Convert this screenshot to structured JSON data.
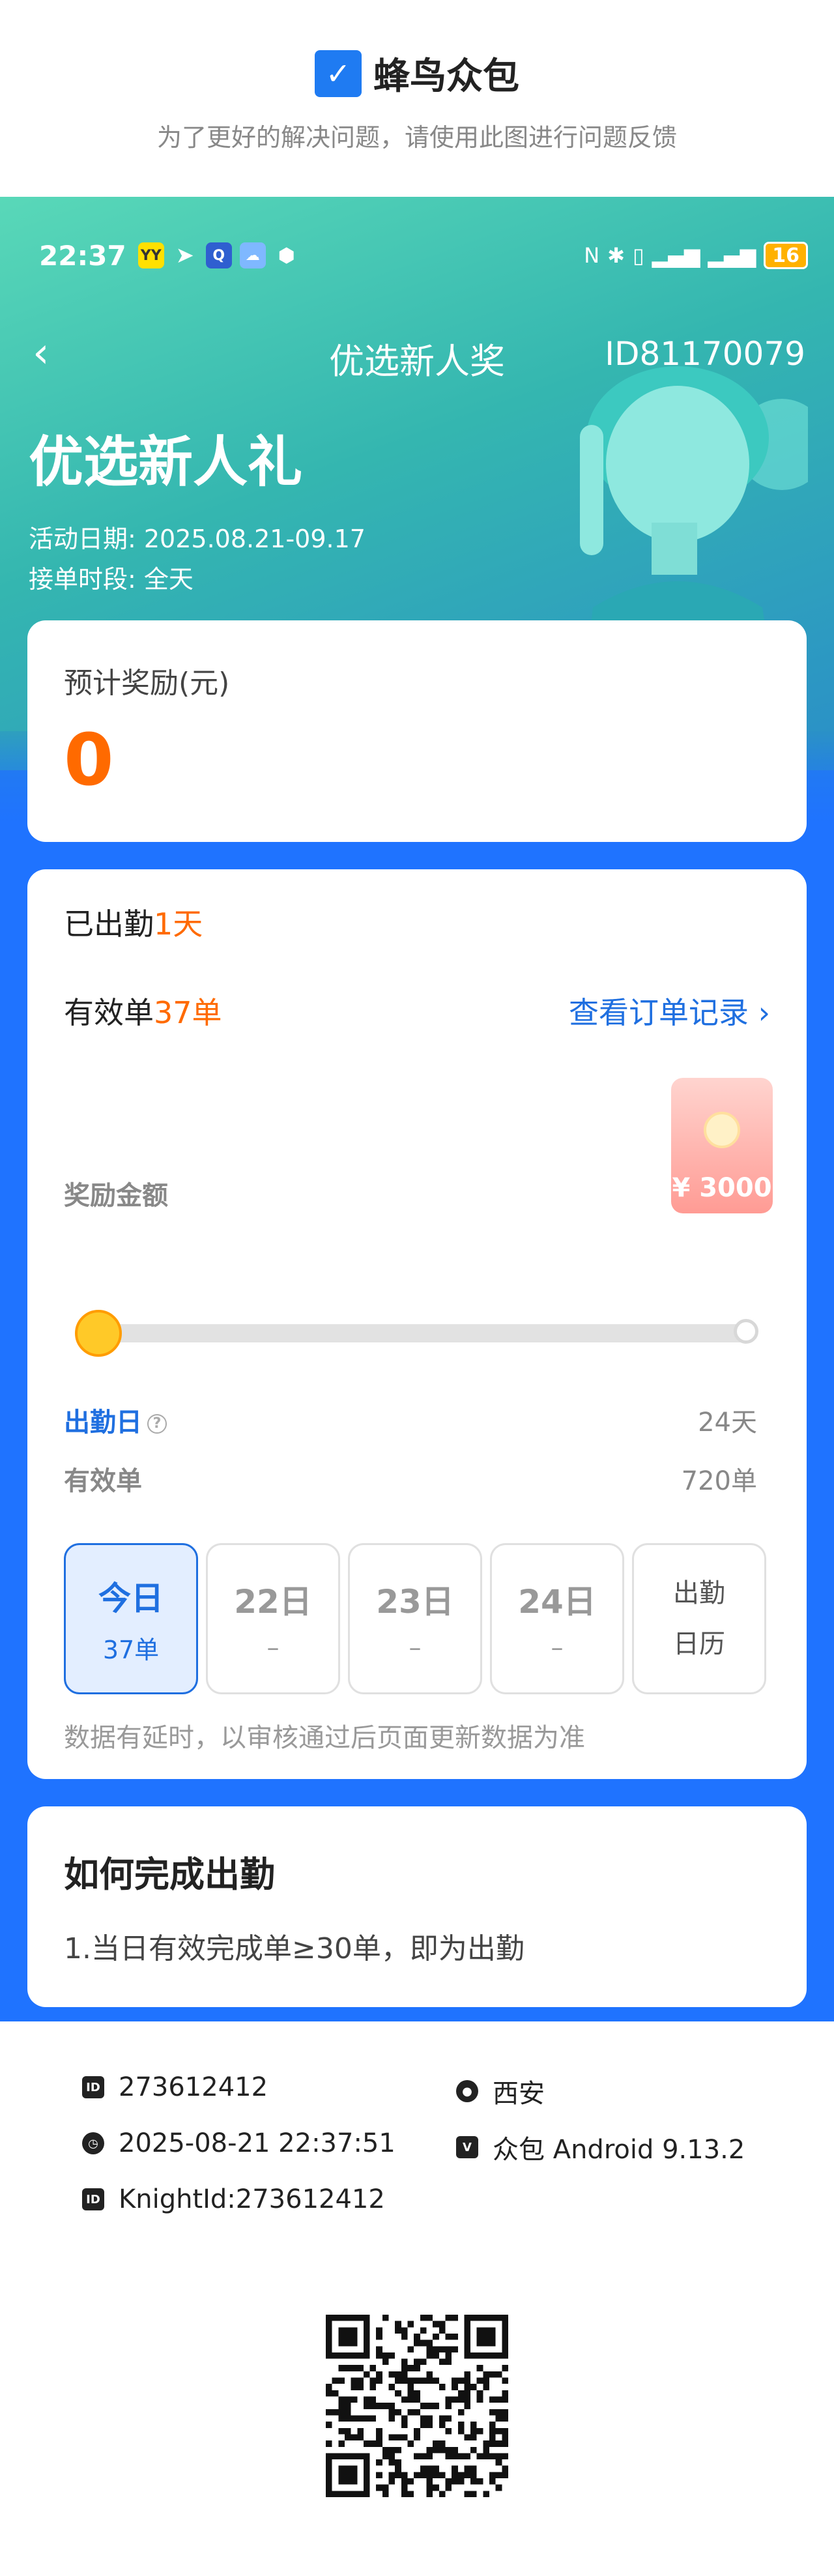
{
  "report": {
    "brand_name": "蜂鸟众包",
    "subtitle": "为了更好的解决问题，请使用此图进行问题反馈"
  },
  "status_bar": {
    "time": "22:37",
    "battery": "16"
  },
  "nav": {
    "back": "‹",
    "title": "优选新人奖",
    "id": "ID81170079"
  },
  "hero": {
    "title": "优选新人礼",
    "activity_date": "活动日期: 2025.08.21-09.17",
    "order_period": "接单时段: 全天"
  },
  "reward_card": {
    "label": "预计奖励(元)",
    "value": "0"
  },
  "progress_card": {
    "attended_prefix": "已出勤",
    "attended_value": "1天",
    "valid_prefix": "有效单",
    "valid_value": "37单",
    "view_orders": "查看订单记录 ›",
    "reward_amount_label": "奖励金额",
    "red_packet_amount": "¥ 3000",
    "progress_fraction": 0.03,
    "attendance_label": "出勤日",
    "attendance_target": "24天",
    "valid_orders_label": "有效单",
    "valid_orders_target": "720单",
    "days": [
      {
        "title": "今日",
        "sub": "37单"
      },
      {
        "title": "22日",
        "sub": "–"
      },
      {
        "title": "23日",
        "sub": "–"
      },
      {
        "title": "24日",
        "sub": "–"
      }
    ],
    "calendar_line1": "出勤",
    "calendar_line2": "日历",
    "note": "数据有延时，以审核通过后页面更新数据为准"
  },
  "how_card": {
    "title": "如何完成出勤",
    "rule": "1.当日有效完成单≥30单，即为出勤"
  },
  "meta": {
    "user_id": "273612412",
    "city": "西安",
    "datetime": "2025-08-21 22:37:51",
    "app_version": "众包 Android 9.13.2",
    "knight_id": "KnightId:273612412"
  },
  "colors": {
    "brand_blue": "#1f73ff",
    "accent_orange": "#ff6a00",
    "link_blue": "#1f6fe0",
    "hero_teal": "#34b6b0"
  }
}
